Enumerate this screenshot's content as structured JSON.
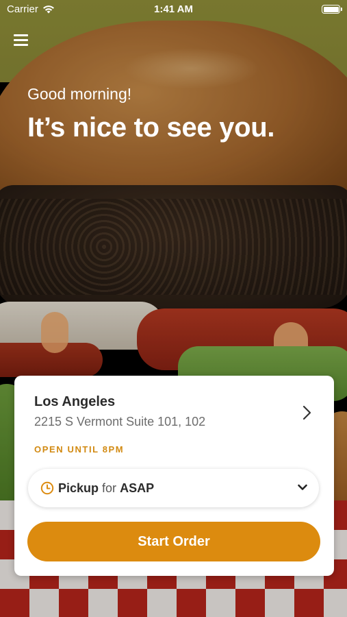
{
  "status_bar": {
    "carrier": "Carrier",
    "time": "1:41 AM"
  },
  "hero": {
    "greeting": "Good morning!",
    "headline": "It’s nice to see you."
  },
  "store": {
    "name": "Los Angeles",
    "address": "2215 S Vermont Suite 101, 102",
    "hours": "OPEN UNTIL 8PM"
  },
  "order_mode": {
    "mode": "Pickup",
    "connector": "for",
    "time": "ASAP"
  },
  "actions": {
    "start_order": "Start Order"
  },
  "colors": {
    "accent": "#dc8b0f",
    "hours_text": "#d28a12"
  },
  "icons": [
    "wifi-icon",
    "battery-icon",
    "menu-icon",
    "chevron-right-icon",
    "clock-icon",
    "chevron-down-icon"
  ]
}
